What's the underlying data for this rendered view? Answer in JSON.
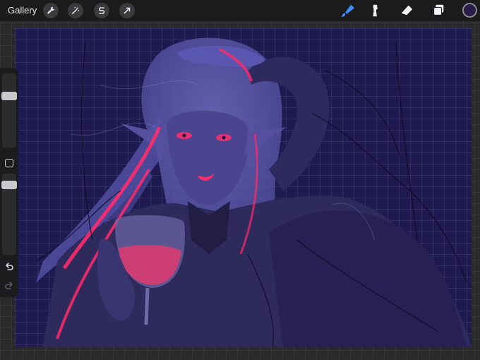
{
  "toolbar": {
    "gallery_label": "Gallery",
    "left_tools": [
      {
        "name": "actions",
        "icon": "wrench-icon"
      },
      {
        "name": "adjustments",
        "icon": "magic-wand-icon"
      },
      {
        "name": "selection",
        "icon": "selection-s-icon"
      },
      {
        "name": "transform",
        "icon": "arrow-cursor-icon"
      }
    ],
    "right_tools": [
      {
        "name": "brush",
        "icon": "brush-icon",
        "active": true
      },
      {
        "name": "smudge",
        "icon": "smudge-icon",
        "active": false
      },
      {
        "name": "eraser",
        "icon": "eraser-icon",
        "active": false
      },
      {
        "name": "layers",
        "icon": "layers-icon",
        "active": false
      }
    ],
    "current_color": "#2a1d4a",
    "active_tool_color": "#3f8cff"
  },
  "sidebar": {
    "brush_size_level": 0.2,
    "opacity_level": 0.15,
    "undo_icon": "undo-icon",
    "redo_icon": "redo-icon",
    "modify_icon": "square-icon"
  },
  "canvas": {
    "background_color": "#1f1a4f",
    "accent_color": "#ff2b6b",
    "subject": "sketch-artwork"
  }
}
